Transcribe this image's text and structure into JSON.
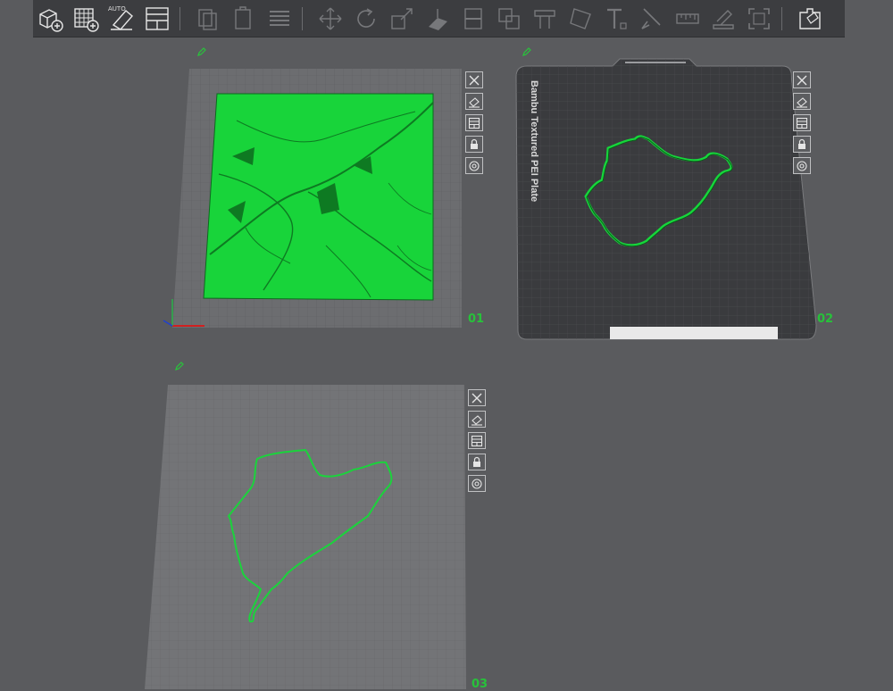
{
  "toolbar": {
    "auto_label": "AUTO",
    "buttons": [
      {
        "name": "add-object-button",
        "icon": "cube-plus-icon",
        "active": true
      },
      {
        "name": "add-plate-button",
        "icon": "grid-plus-icon",
        "active": true
      },
      {
        "name": "auto-orient-button",
        "icon": "auto-orient-icon",
        "active": true
      },
      {
        "name": "arrange-button",
        "icon": "arrange-icon",
        "active": true
      },
      {
        "name": "copy-button",
        "icon": "copy-icon",
        "active": false
      },
      {
        "name": "paste-button",
        "icon": "paste-icon",
        "active": false
      },
      {
        "name": "layers-button",
        "icon": "layers-icon",
        "active": false
      },
      {
        "name": "move-button",
        "icon": "move-icon",
        "active": false
      },
      {
        "name": "rotate-button",
        "icon": "rotate-icon",
        "active": false
      },
      {
        "name": "scale-button",
        "icon": "scale-icon",
        "active": false
      },
      {
        "name": "lay-on-face-button",
        "icon": "lay-on-face-icon",
        "active": false
      },
      {
        "name": "cut-button",
        "icon": "cut-icon",
        "active": false
      },
      {
        "name": "boolean-button",
        "icon": "boolean-icon",
        "active": false
      },
      {
        "name": "support-paint-button",
        "icon": "support-paint-icon",
        "active": false
      },
      {
        "name": "variable-layer-button",
        "icon": "variable-layer-icon",
        "active": false
      },
      {
        "name": "text-button",
        "icon": "text-icon",
        "active": false
      },
      {
        "name": "color-paint-button",
        "icon": "color-paint-icon",
        "active": false
      },
      {
        "name": "measure-button",
        "icon": "measure-icon",
        "active": false
      },
      {
        "name": "seam-paint-button",
        "icon": "seam-paint-icon",
        "active": false
      },
      {
        "name": "fit-view-button",
        "icon": "fit-view-icon",
        "active": false
      },
      {
        "name": "assembly-button",
        "icon": "assembly-icon",
        "active": true
      }
    ]
  },
  "plates": [
    {
      "number": "01",
      "content": "terrain-map-model"
    },
    {
      "number": "02",
      "label": "Bambu Textured PEI Plate",
      "content": "track-outline-model"
    },
    {
      "number": "03",
      "content": "track-outline-model"
    }
  ],
  "plate_tools": [
    "close-icon",
    "image-icon",
    "arrange-icon",
    "lock-icon",
    "settings-icon"
  ],
  "colors": {
    "accent": "#27c23a",
    "background": "#5a5b5e",
    "toolbar": "#3c3d40",
    "plate": "#6e6f72",
    "plate_dark": "#3d3e41",
    "model": "#16d63b"
  }
}
